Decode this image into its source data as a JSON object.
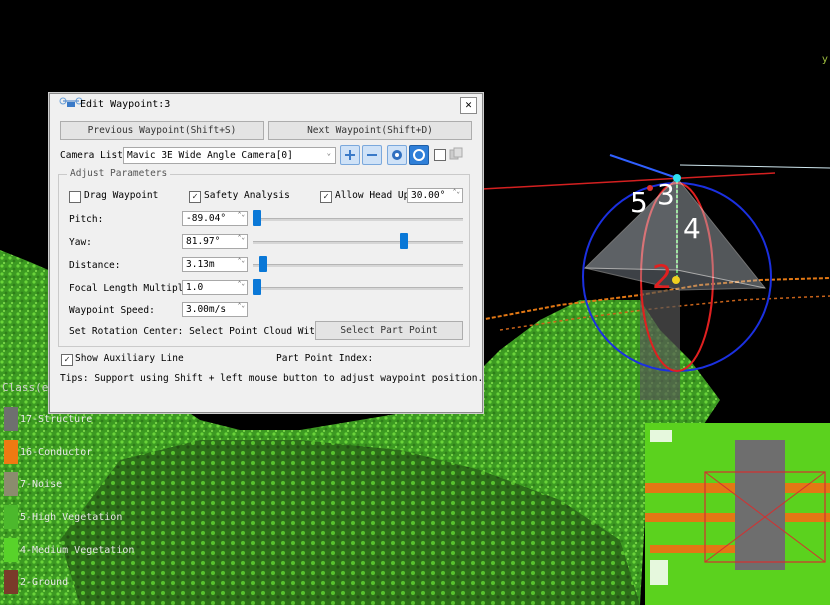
{
  "dialog": {
    "title": "Edit Waypoint:3",
    "close_glyph": "✕",
    "prev_label": "Previous Waypoint(Shift+S)",
    "next_label": "Next Waypoint(Shift+D)",
    "camera_list_label": "Camera List:",
    "camera_value": "Mavic 3E Wide Angle Camera[0]",
    "group_title": "Adjust Parameters",
    "drag_waypoint": {
      "label": "Drag Waypoint",
      "checked": false
    },
    "safety_analysis": {
      "label": "Safety Analysis",
      "checked": true
    },
    "allow_head_up": {
      "label": "Allow Head Up",
      "checked": true,
      "value": "30.00°"
    },
    "params": [
      {
        "label": "Pitch:",
        "value": "-89.04°",
        "slider": 0.0
      },
      {
        "label": "Yaw:",
        "value": "81.97°",
        "slider": 0.72
      },
      {
        "label": "Distance:",
        "value": "3.13m",
        "slider": 0.03
      },
      {
        "label": "Focal Length Multiple:",
        "value": "1.0",
        "slider": 0.0
      }
    ],
    "waypoint_speed": {
      "label": "Waypoint Speed:",
      "value": "3.00m/s"
    },
    "rotation_center_label": "Set Rotation Center: Select Point Cloud With Ctrl",
    "select_part_point_label": "Select Part Point",
    "show_aux_line": {
      "label": "Show Auxiliary Line",
      "checked": true
    },
    "part_point_index_label": "Part Point Index:",
    "tips": "Tips: Support using Shift + left mouse button to adjust waypoint position.",
    "check_glyph": "✓",
    "spin_arrows": "⌃⌄",
    "combo_arrow": "⌄"
  },
  "legend": {
    "title": "Class(es",
    "items": [
      {
        "label": "17-Structure",
        "color": "#6f6f6f"
      },
      {
        "label": "16-Conductor",
        "color": "#f07a12"
      },
      {
        "label": "7-Noise",
        "color": "#8c8c6e"
      },
      {
        "label": "5-High Vegetation",
        "color": "#4cb82c"
      },
      {
        "label": "4-Medium Vegetation",
        "color": "#58d22a"
      },
      {
        "label": "2-Ground",
        "color": "#7a3a2a"
      }
    ]
  },
  "scene": {
    "waypoint_labels": [
      "5",
      "3",
      "4",
      "2"
    ],
    "axis_label": "y"
  },
  "colors": {
    "accent": "#0a78d7",
    "vegetation": "#4cb82c",
    "conductor": "#f07a12"
  }
}
